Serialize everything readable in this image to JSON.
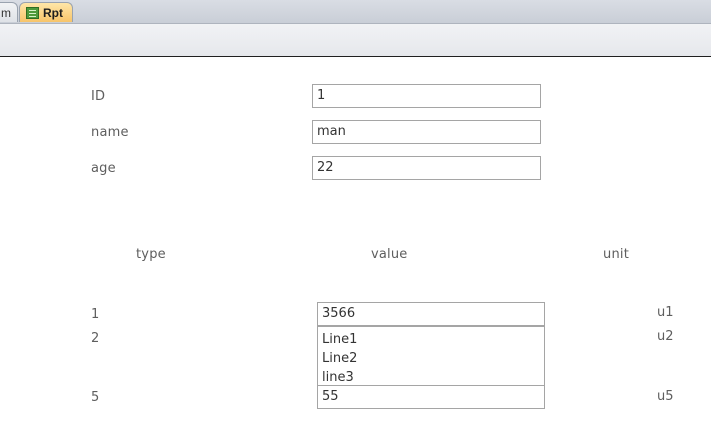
{
  "tabs": [
    {
      "label": "m",
      "active": false
    },
    {
      "label": "Rpt",
      "active": true,
      "icon": "report-icon"
    }
  ],
  "form": {
    "id": {
      "label": "ID",
      "value": "1"
    },
    "name": {
      "label": "name",
      "value": "man"
    },
    "age": {
      "label": "age",
      "value": "22"
    }
  },
  "table": {
    "headers": {
      "type": "type",
      "value": "value",
      "unit": "unit"
    },
    "rows": [
      {
        "type": "1",
        "value": [
          "3566"
        ],
        "unit": "u1"
      },
      {
        "type": "2",
        "value": [
          "Line1",
          "Line2",
          "line3"
        ],
        "unit": "u2"
      },
      {
        "type": "5",
        "value": [
          "55"
        ],
        "unit": "u5"
      }
    ]
  },
  "colors": {
    "active_tab": "#f7c46a",
    "field_border": "#a5a5a5"
  }
}
